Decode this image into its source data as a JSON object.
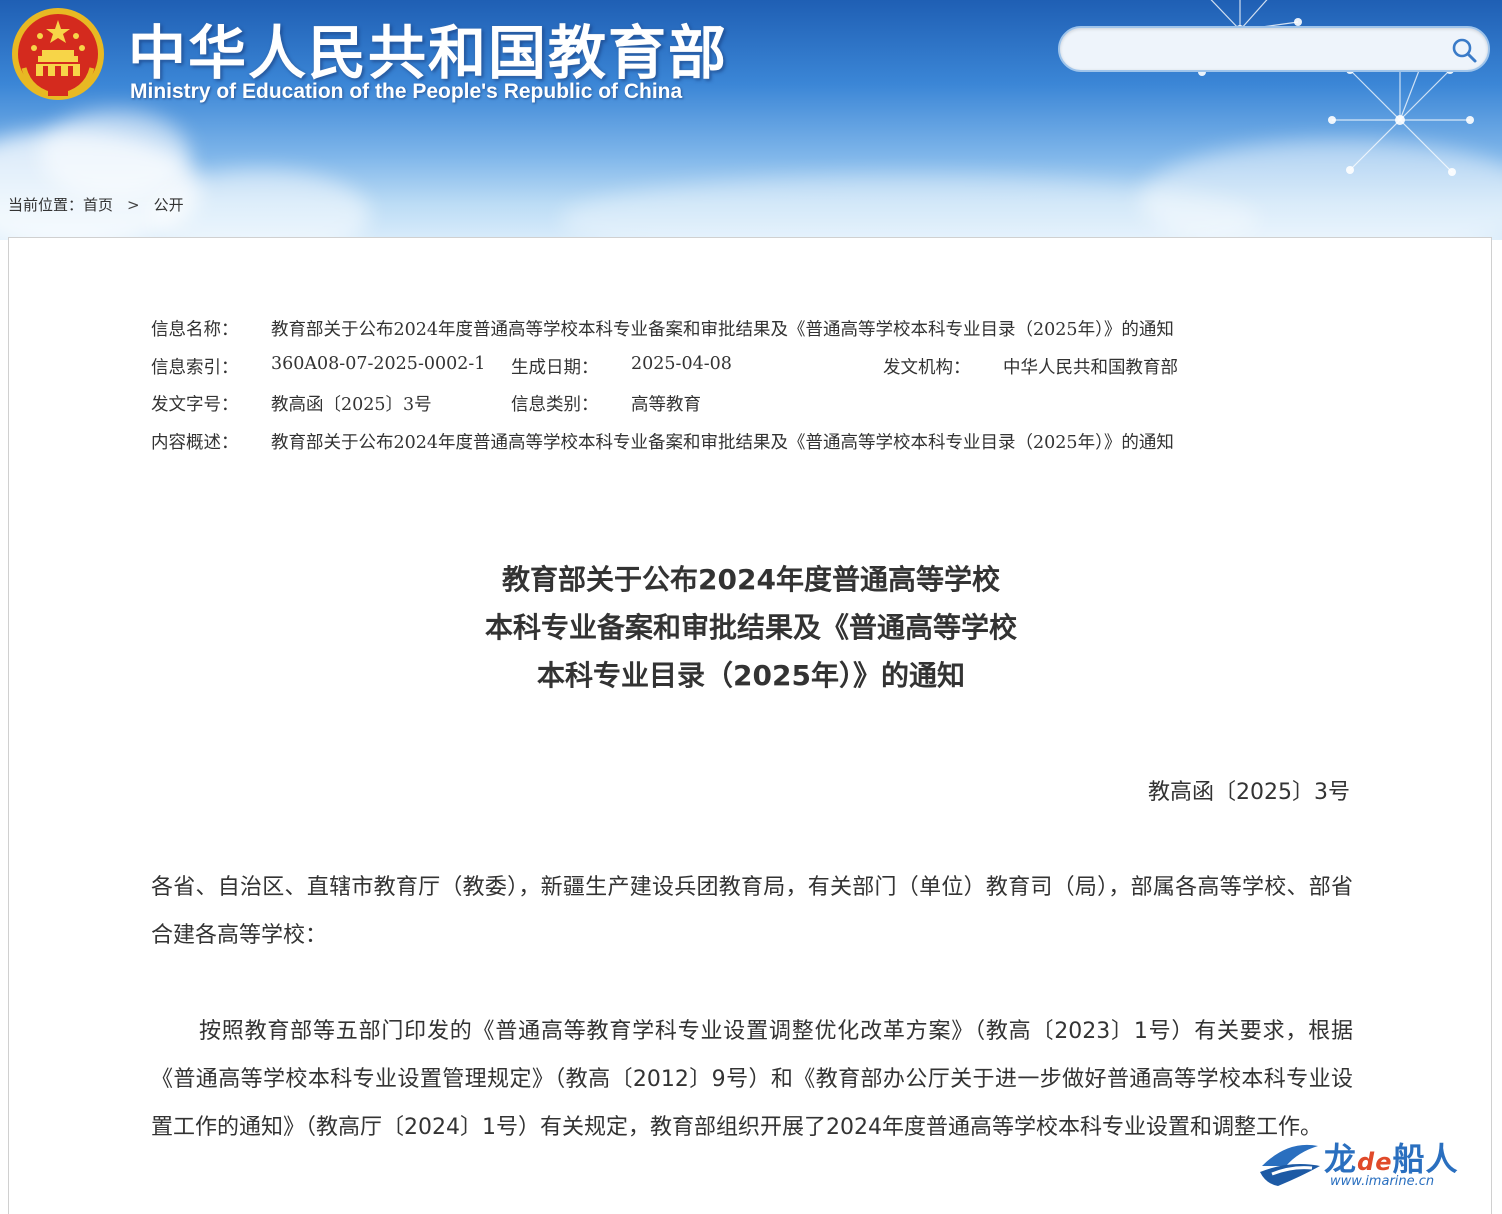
{
  "header": {
    "title": "中华人民共和国教育部",
    "subtitle": "Ministry of Education of the People's Republic of China",
    "emblem": "national-emblem",
    "search": {
      "placeholder": "",
      "icon": "search-icon"
    }
  },
  "breadcrumb": {
    "label": "当前位置：",
    "items": [
      "首页",
      "公开"
    ],
    "separator": ">"
  },
  "meta": {
    "name_label": "信息名称：",
    "name_value": "教育部关于公布2024年度普通高等学校本科专业备案和审批结果及《普通高等学校本科专业目录（2025年）》的通知",
    "index_label": "信息索引：",
    "index_value": "360A08-07-2025-0002-1",
    "date_label": "生成日期：",
    "date_value": "2025-04-08",
    "org_label": "发文机构：",
    "org_value": "中华人民共和国教育部",
    "docno_label": "发文字号：",
    "docno_value": "教高函〔2025〕3号",
    "category_label": "信息类别：",
    "category_value": "高等教育",
    "summary_label": "内容概述：",
    "summary_value": "教育部关于公布2024年度普通高等学校本科专业备案和审批结果及《普通高等学校本科专业目录（2025年）》的通知"
  },
  "document": {
    "title_lines": [
      "教育部关于公布2024年度普通高等学校",
      "本科专业备案和审批结果及《普通高等学校",
      "本科专业目录（2025年）》的通知"
    ],
    "doc_number": "教高函〔2025〕3号",
    "salutation": "各省、自治区、直辖市教育厅（教委），新疆生产建设兵团教育局，有关部门（单位）教育司（局），部属各高等学校、部省合建各高等学校：",
    "paragraph1": "按照教育部等五部门印发的《普通高等教育学科专业设置调整优化改革方案》（教高〔2023〕1号）有关要求，根据《普通高等学校本科专业设置管理规定》（教高〔2012〕9号）和《教育部办公厅关于进一步做好普通高等学校本科专业设置工作的通知》（教高厅〔2024〕1号）有关规定，教育部组织开展了2024年度普通高等学校本科专业设置和调整工作。"
  },
  "watermark": {
    "name_prefix": "龙",
    "name_de": "de",
    "name_suffix": "船人",
    "url": "www.imarine.cn"
  },
  "colors": {
    "header_top": "#1f5fb4",
    "header_bottom": "#d9ecfb",
    "text": "#333333",
    "watermark_blue": "#2a6fbf",
    "watermark_red": "#e04a2a"
  }
}
